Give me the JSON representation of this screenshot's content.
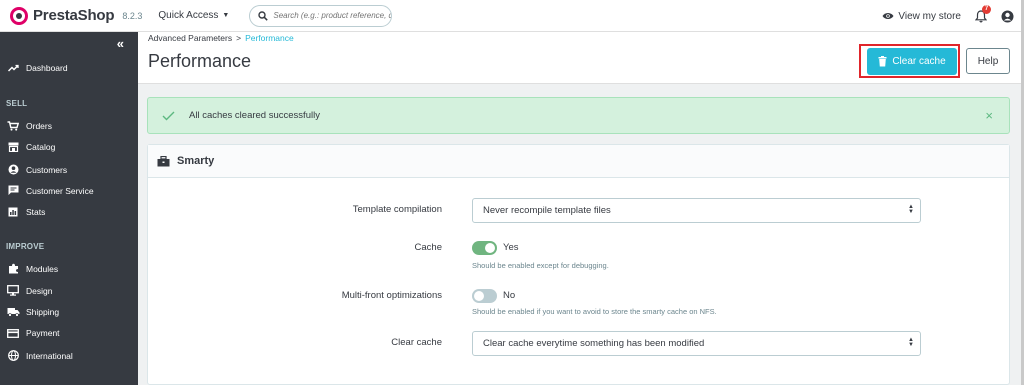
{
  "header": {
    "logo_text": "PrestaShop",
    "version": "8.2.3",
    "quick_access": "Quick Access",
    "search_placeholder": "Search (e.g.: product reference, custon",
    "view_store": "View my store",
    "notification_count": "7"
  },
  "sidebar": {
    "collapse_icon": "«",
    "dashboard": "Dashboard",
    "sections": [
      {
        "title": "SELL",
        "items": [
          {
            "label": "Orders",
            "icon": "cart-icon"
          },
          {
            "label": "Catalog",
            "icon": "store-icon"
          },
          {
            "label": "Customers",
            "icon": "user-icon"
          },
          {
            "label": "Customer Service",
            "icon": "chat-icon"
          },
          {
            "label": "Stats",
            "icon": "chart-icon"
          }
        ]
      },
      {
        "title": "IMPROVE",
        "items": [
          {
            "label": "Modules",
            "icon": "puzzle-icon"
          },
          {
            "label": "Design",
            "icon": "desktop-icon"
          },
          {
            "label": "Shipping",
            "icon": "truck-icon"
          },
          {
            "label": "Payment",
            "icon": "card-icon"
          },
          {
            "label": "International",
            "icon": "globe-icon"
          }
        ]
      }
    ]
  },
  "page": {
    "breadcrumb_parent": "Advanced Parameters",
    "breadcrumb_sep": ">",
    "breadcrumb_current": "Performance",
    "title": "Performance",
    "clear_cache_button": "Clear cache",
    "help_button": "Help"
  },
  "alert": {
    "message": "All caches cleared successfully",
    "close": "×"
  },
  "panel": {
    "title": "Smarty",
    "fields": {
      "template_compilation": {
        "label": "Template compilation",
        "value": "Never recompile template files"
      },
      "cache": {
        "label": "Cache",
        "value": "Yes",
        "enabled": true,
        "help": "Should be enabled except for debugging."
      },
      "multi_front": {
        "label": "Multi-front optimizations",
        "value": "No",
        "enabled": false,
        "help": "Should be enabled if you want to avoid to store the smarty cache on NFS."
      },
      "clear_cache": {
        "label": "Clear cache",
        "value": "Clear cache everytime something has been modified"
      }
    }
  },
  "colors": {
    "accent": "#25b9d7",
    "sidebar_bg": "#363a41",
    "success_bg": "#d4f1dd",
    "toggle_on": "#70b580",
    "highlight_border": "#e0252b"
  }
}
